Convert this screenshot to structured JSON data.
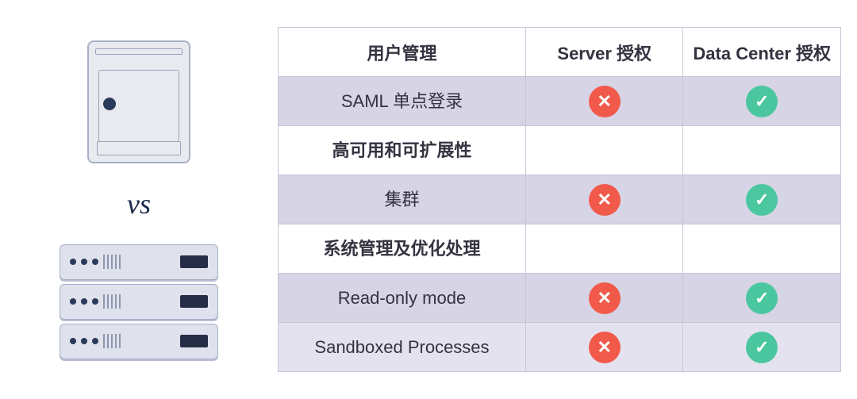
{
  "vs_label": "vs",
  "headers": {
    "feature": "用户管理",
    "server": "Server 授权",
    "datacenter": "Data Center 授权"
  },
  "rows": [
    {
      "type": "data",
      "feature": "SAML 单点登录",
      "server": "no",
      "datacenter": "yes"
    },
    {
      "type": "section",
      "feature": "高可用和可扩展性"
    },
    {
      "type": "data",
      "feature": "集群",
      "server": "no",
      "datacenter": "yes"
    },
    {
      "type": "section",
      "feature": "系统管理及优化处理"
    },
    {
      "type": "data",
      "feature": "Read-only mode",
      "server": "no",
      "datacenter": "yes"
    },
    {
      "type": "data",
      "alt": true,
      "feature": "Sandboxed Processes",
      "server": "no",
      "datacenter": "yes"
    }
  ],
  "icons": {
    "no": "cross-icon",
    "yes": "check-icon"
  }
}
